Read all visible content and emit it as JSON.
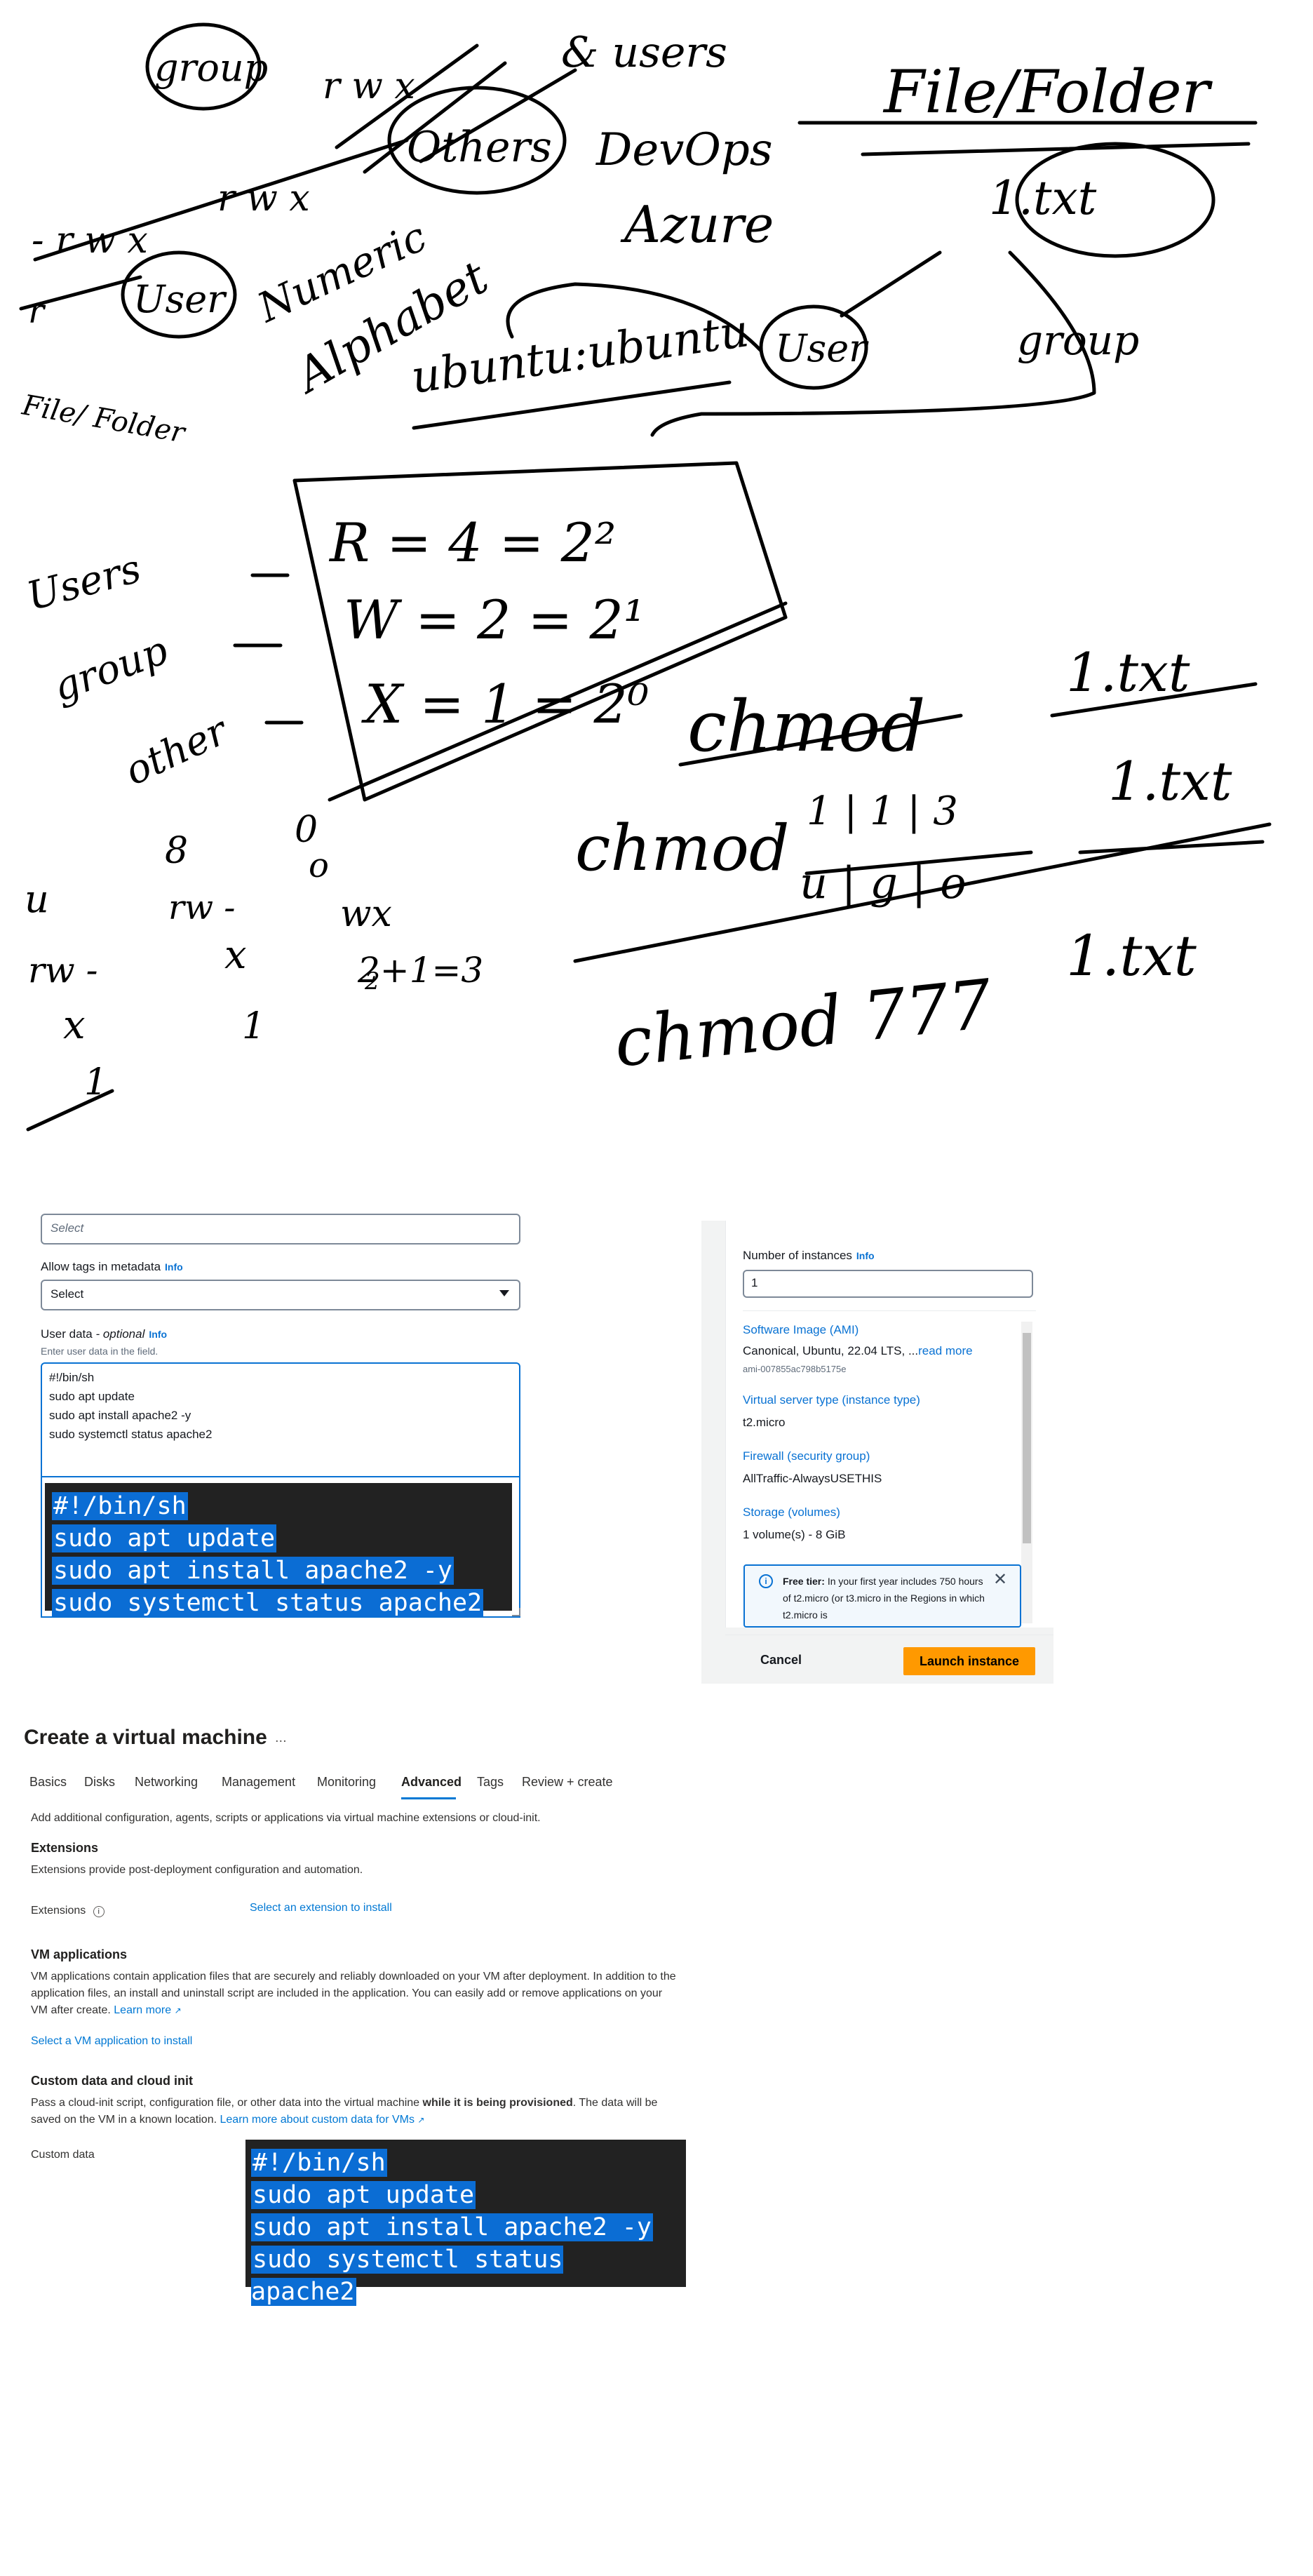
{
  "whiteboard": {
    "labels": {
      "group_circled": "group",
      "rwx_top": "r w x",
      "users_top": "& users",
      "file_folder": "File/Folder",
      "rwx_left": "- r w x",
      "rwx_mid": "r w x",
      "dash_line": "- - - - - - - - -",
      "others_circled": "Others",
      "devops": "DevOps",
      "azure": "Azure",
      "file_txt_circled": "1.txt",
      "user_circled_left": "User",
      "numeric": "Numeric",
      "alphabet": "Alphabet",
      "file_folder_small": "File/ Folder",
      "ubuntu_owner": "ubuntu:ubuntu",
      "user_circled_right": "User",
      "group_right": "group",
      "users_left": "Users",
      "group_left": "group",
      "other_left": "other",
      "r_eq": "R = 4 = 2²",
      "w_eq": "W = 2 = 2¹",
      "x_eq": "X = 1 = 2⁰",
      "chmod_heading": "chmod",
      "txt_top": "1.txt",
      "chmod_fraction": "chmod",
      "fraction_num": "1 | 1 | 3",
      "fraction_den": "u | g | o",
      "txt_mid": "1.txt",
      "chmod_777": "chmod 777",
      "txt_bottom": "1.txt",
      "eight": "8",
      "zero": "0",
      "rw_mid": "rw -",
      "x_mid": "x",
      "one_small": "1",
      "o_small": "o",
      "wx_small": "wx",
      "calc_small": "2+1=3",
      "u_left": "u",
      "rw_left": "rw -",
      "x_left": "x",
      "one_left": "1",
      "two_small": "2",
      "r_left_dash": "r"
    }
  },
  "aws": {
    "select_placeholder": "Select",
    "allow_tags_label": "Allow tags in metadata",
    "info": "Info",
    "allow_tags_value": "Select",
    "user_data_label": "User data",
    "user_data_optional": "- optional",
    "user_data_hint": "Enter user data in the field.",
    "user_data_lines": [
      "#!/bin/sh",
      "sudo apt update",
      "sudo apt install apache2 -y",
      "sudo systemctl status apache2"
    ],
    "terminal_lines": [
      "#!/bin/sh",
      "sudo apt update",
      "sudo apt install apache2 -y",
      "sudo systemctl status apache2"
    ],
    "summary": {
      "instances_label": "Number of instances",
      "instances_value": "1",
      "ami_label": "Software Image (AMI)",
      "ami_value": "Canonical, Ubuntu, 22.04 LTS, ...",
      "ami_more": "read more",
      "ami_id": "ami-007855ac798b5175e",
      "type_label": "Virtual server type (instance type)",
      "type_value": "t2.micro",
      "firewall_label": "Firewall (security group)",
      "firewall_value": "AllTraffic-AlwaysUSETHIS",
      "storage_label": "Storage (volumes)",
      "storage_value": "1 volume(s) - 8 GiB",
      "free_tier_bold": "Free tier:",
      "free_tier_text": "In your first year includes 750 hours of t2.micro (or t3.micro in the Regions in which t2.micro is",
      "cancel": "Cancel",
      "launch": "Launch instance"
    }
  },
  "azure": {
    "title": "Create a virtual machine",
    "more": "...",
    "tabs": [
      "Basics",
      "Disks",
      "Networking",
      "Management",
      "Monitoring",
      "Advanced",
      "Tags",
      "Review + create"
    ],
    "intro": "Add additional configuration, agents, scripts or applications via virtual machine extensions or cloud-init.",
    "extensions_heading": "Extensions",
    "extensions_desc": "Extensions provide post-deployment configuration and automation.",
    "extensions_label": "Extensions",
    "extensions_link": "Select an extension to install",
    "vmapps_heading": "VM applications",
    "vmapps_desc": "VM applications contain application files that are securely and reliably downloaded on your VM after deployment. In addition to the application files, an install and uninstall script are included in the application. You can easily add or remove applications on your VM after create.",
    "learn_more": "Learn more",
    "vmapps_link": "Select a VM application to install",
    "custom_heading": "Custom data and cloud init",
    "custom_desc_1": "Pass a cloud-init script, configuration file, or other data into the virtual machine",
    "custom_desc_bold": "while it is being provisioned",
    "custom_desc_2": ". The data will be saved on the VM in a known location.",
    "custom_learn_more": "Learn more about custom data for VMs",
    "custom_label": "Custom data",
    "terminal_lines": [
      "#!/bin/sh",
      "sudo apt update",
      "sudo apt install apache2 -y",
      "sudo systemctl status apache2"
    ]
  }
}
